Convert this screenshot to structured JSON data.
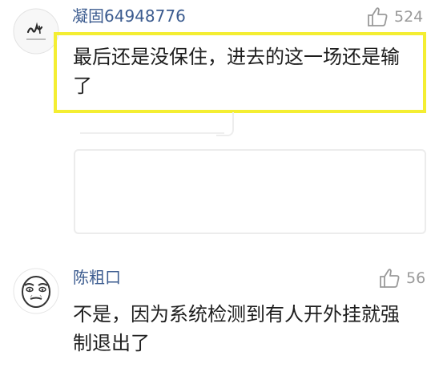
{
  "comments": [
    {
      "username": "凝固64948776",
      "likes": "524",
      "text_line1": "最后还是没保住，进去的这一场还是输",
      "text_line2": "了",
      "highlighted": true,
      "highlight_color": "#f4ee32"
    },
    {
      "username": "陈粗口",
      "likes": "56",
      "text_line1": "不是，因为系统检测到有人开外挂就强",
      "text_line2": "制退出了"
    }
  ],
  "colors": {
    "username": "#3b5b8f",
    "like": "#9a9a9a",
    "text": "#1e1e1e"
  },
  "icons": {
    "like": "thumbs-up-outline-icon"
  }
}
